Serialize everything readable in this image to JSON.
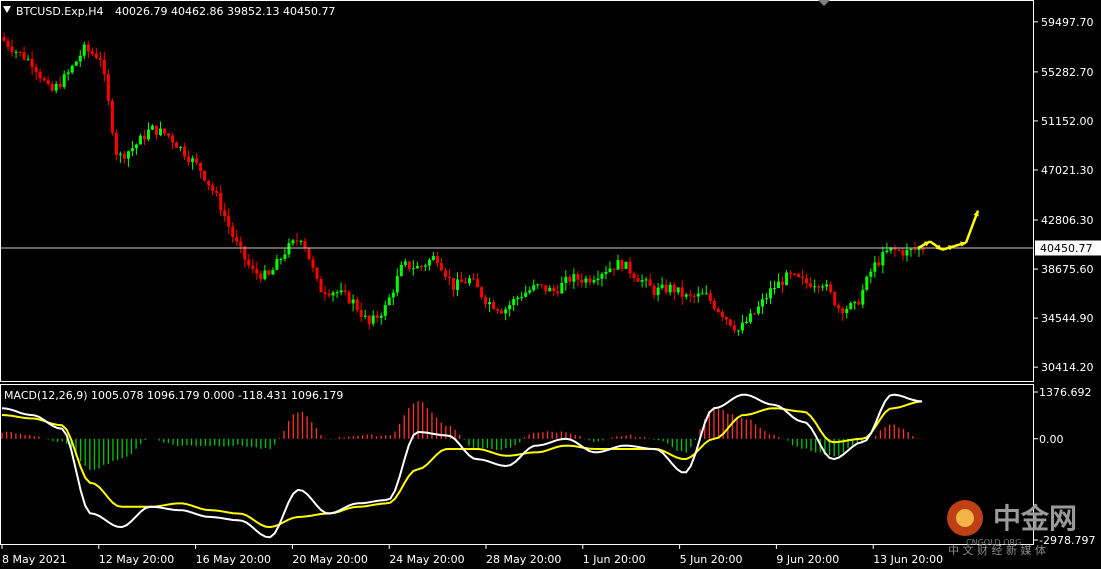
{
  "header": {
    "symbol": "BTCUSD.Exp,H4",
    "ohlc": "40026.79 40462.86 39852.13 40450.77",
    "collapse_icon": "triangle-down-icon"
  },
  "price_axis": {
    "ticks": [
      "59497.70",
      "55282.70",
      "51152.00",
      "47021.30",
      "42806.30",
      "38675.60",
      "34544.90",
      "30414.20"
    ],
    "current_price": "40450.77"
  },
  "macd": {
    "label": "MACD(12,26,9) 1005.078 1096.179 0.000 -118.431 1096.179",
    "ticks": [
      "1376.692",
      "0.00",
      "-2978.797"
    ]
  },
  "time_axis": {
    "ticks": [
      "8 May 2021",
      "12 May 20:00",
      "16 May 20:00",
      "20 May 20:00",
      "24 May 20:00",
      "28 May 20:00",
      "1 Jun 20:00",
      "5 Jun 20:00",
      "9 Jun 20:00",
      "13 Jun 20:00"
    ]
  },
  "watermark": {
    "brand": "中金网",
    "domain": "CNGOLD.ORG",
    "tagline": "中 文 财 经 新 媒 体"
  },
  "colors": {
    "background": "#000000",
    "bull": "#00ff00",
    "bear": "#ff0000",
    "grid": "#ffffff",
    "macd_line": "#ffffff",
    "signal_line": "#ffff00",
    "projection": "#ffff00",
    "hist_pos": "#ff3030",
    "hist_neg": "#00c800"
  },
  "chart_data": [
    {
      "type": "candlestick",
      "title": "BTCUSD.Exp,H4",
      "x": [
        "8 May 2021",
        "12 May 20:00",
        "16 May 20:00",
        "20 May 20:00",
        "24 May 20:00",
        "28 May 20:00",
        "1 Jun 20:00",
        "5 Jun 20:00",
        "9 Jun 20:00",
        "13 Jun 20:00"
      ],
      "close_path": [
        58200,
        57000,
        56000,
        53500,
        55000,
        57200,
        56500,
        48000,
        49000,
        50500,
        50000,
        48500,
        47000,
        44500,
        41000,
        38500,
        38000,
        40200,
        41500,
        37000,
        36800,
        36000,
        34000,
        35500,
        39000,
        38800,
        39800,
        37200,
        37800,
        36000,
        35200,
        36500,
        37200,
        36800,
        37900,
        37800,
        38600,
        39200,
        38000,
        36800,
        37100,
        36200,
        36500,
        35000,
        33500,
        35000,
        37000,
        38100,
        37500,
        37600,
        35400,
        35500,
        38800,
        40300,
        40100,
        40450.77
      ],
      "projection": [
        40450.77,
        41000,
        40300,
        40600,
        40900,
        43600
      ],
      "ylim": [
        29500,
        61000
      ]
    },
    {
      "type": "line",
      "title": "MACD(12,26,9)",
      "series": [
        {
          "name": "MACD",
          "values": [
            900,
            700,
            300,
            -2200,
            -2600,
            -2000,
            -2100,
            -2300,
            -2400,
            -2900,
            -1500,
            -2200,
            -1900,
            -1800,
            200,
            100,
            -600,
            -800,
            -200,
            0,
            -400,
            -200,
            -300,
            -1000,
            900,
            1300,
            1000,
            500,
            -600,
            -100,
            1300,
            1100
          ]
        },
        {
          "name": "Signal",
          "values": [
            700,
            600,
            400,
            -1300,
            -2000,
            -2000,
            -1900,
            -2100,
            -2200,
            -2600,
            -2300,
            -2200,
            -2000,
            -1900,
            -900,
            -300,
            -300,
            -500,
            -400,
            -200,
            -300,
            -300,
            -300,
            -600,
            0,
            700,
            900,
            800,
            -100,
            0,
            900,
            1096
          ]
        }
      ],
      "histogram": [
        200,
        100,
        -100,
        -900,
        -600,
        0,
        -200,
        -200,
        -200,
        -300,
        800,
        0,
        100,
        100,
        1100,
        400,
        -300,
        -300,
        200,
        200,
        -100,
        100,
        0,
        -400,
        900,
        600,
        100,
        -300,
        -500,
        -100,
        400,
        10
      ],
      "ylim": [
        -2978.797,
        1376.692
      ]
    }
  ]
}
